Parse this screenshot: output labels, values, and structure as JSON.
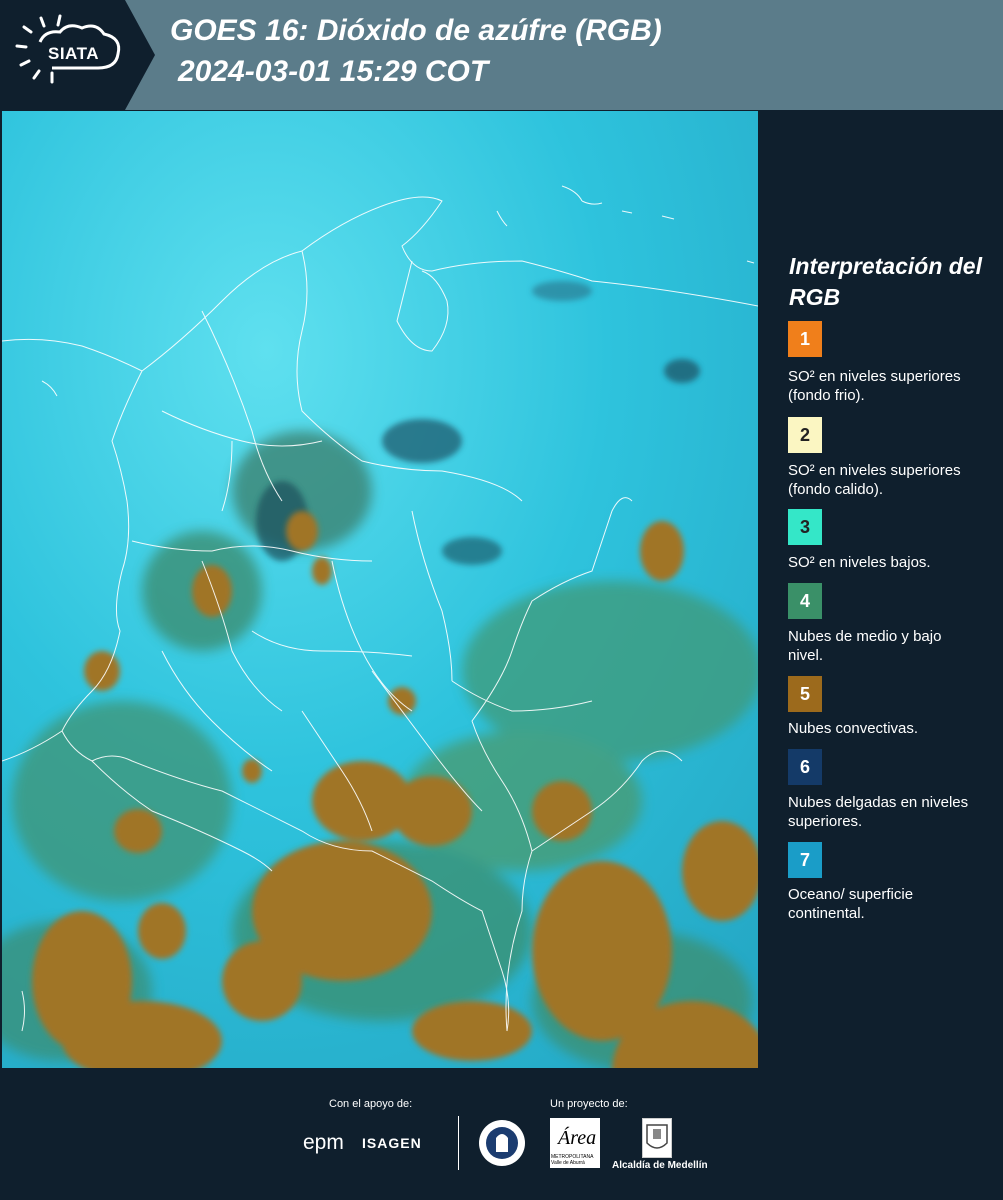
{
  "header": {
    "logo_text": "SIATA",
    "title_line1": "GOES 16: Dióxido de azúfre (RGB)",
    "title_line2": "2024-03-01 15:29 COT",
    "colors": {
      "header_bg": "#5b7c8a",
      "logo_bg": "#0f1f2d"
    }
  },
  "legend": {
    "title": "Interpretación del RGB",
    "items": [
      {
        "number": "1",
        "color": "#f07f1b",
        "text": "SO² en niveles superiores (fondo frio)."
      },
      {
        "number": "2",
        "color": "#fbf6c2",
        "text": "SO² en niveles superiores (fondo calido)."
      },
      {
        "number": "3",
        "color": "#34e7c8",
        "text": "SO² en niveles bajos."
      },
      {
        "number": "4",
        "color": "#3a9068",
        "text": "Nubes de medio y bajo nivel."
      },
      {
        "number": "5",
        "color": "#9c6a1c",
        "text": "Nubes convectivas."
      },
      {
        "number": "6",
        "color": "#143a68",
        "text": "Nubes delgadas en niveles superiores."
      },
      {
        "number": "7",
        "color": "#1a9dc8",
        "text": "Oceano/ superficie continental."
      }
    ]
  },
  "footer": {
    "support_label": "Con el apoyo de:",
    "project_label": "Un proyecto de:",
    "sponsor_epm": "epm",
    "sponsor_isagen": "ISAGEN",
    "area_logo_text": "Área",
    "area_sub": "METROPOLITANA Valle de Aburrá",
    "alcaldia_label": "Alcaldía de Medellín"
  }
}
